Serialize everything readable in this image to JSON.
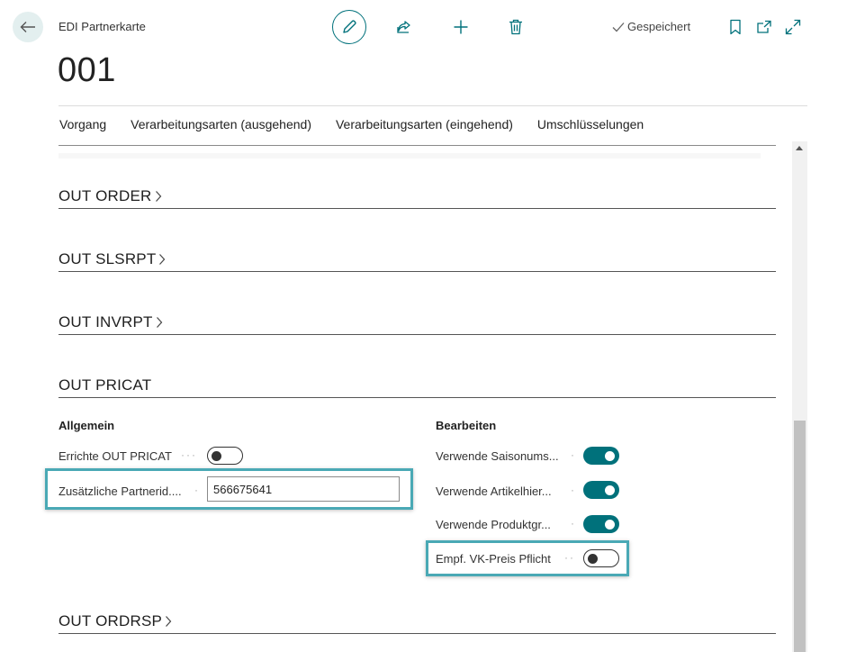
{
  "header": {
    "page_caption": "EDI Partnerkarte",
    "saved_status": "Gespeichert",
    "record_title": "001"
  },
  "icons": {
    "back": "arrow-left-icon",
    "edit": "pencil-icon",
    "share": "share-icon",
    "new": "plus-icon",
    "delete": "trash-icon",
    "saved": "check-icon",
    "bookmark": "bookmark-icon",
    "open_new_window": "open-new-window-icon",
    "expand": "expand-icon"
  },
  "menu": {
    "items": [
      {
        "label": "Vorgang"
      },
      {
        "label": "Verarbeitungsarten (ausgehend)"
      },
      {
        "label": "Verarbeitungsarten (eingehend)"
      },
      {
        "label": "Umschlüsselungen"
      }
    ]
  },
  "sections": {
    "out_order": "OUT ORDER",
    "out_slsrpt": "OUT SLSRPT",
    "out_invrpt": "OUT INVRPT",
    "out_pricat": "OUT PRICAT",
    "out_ordrsp": "OUT ORDRSP"
  },
  "pricat": {
    "allgemein": {
      "title": "Allgemein",
      "errichte_label": "Errichte OUT PRICAT",
      "errichte_value": false,
      "partnerid_label": "Zusätzliche Partnerid....",
      "partnerid_value": "566675641"
    },
    "bearbeiten": {
      "title": "Bearbeiten",
      "saison_label": "Verwende Saisonums...",
      "saison_value": true,
      "artikelhier_label": "Verwende Artikelhier...",
      "artikelhier_value": true,
      "produktgr_label": "Verwende Produktgr...",
      "produktgr_value": true,
      "vkpreis_label": "Empf. VK-Preis Pflicht",
      "vkpreis_value": false
    }
  },
  "colors": {
    "accent": "#00717b",
    "highlight": "#4aa9b5"
  }
}
